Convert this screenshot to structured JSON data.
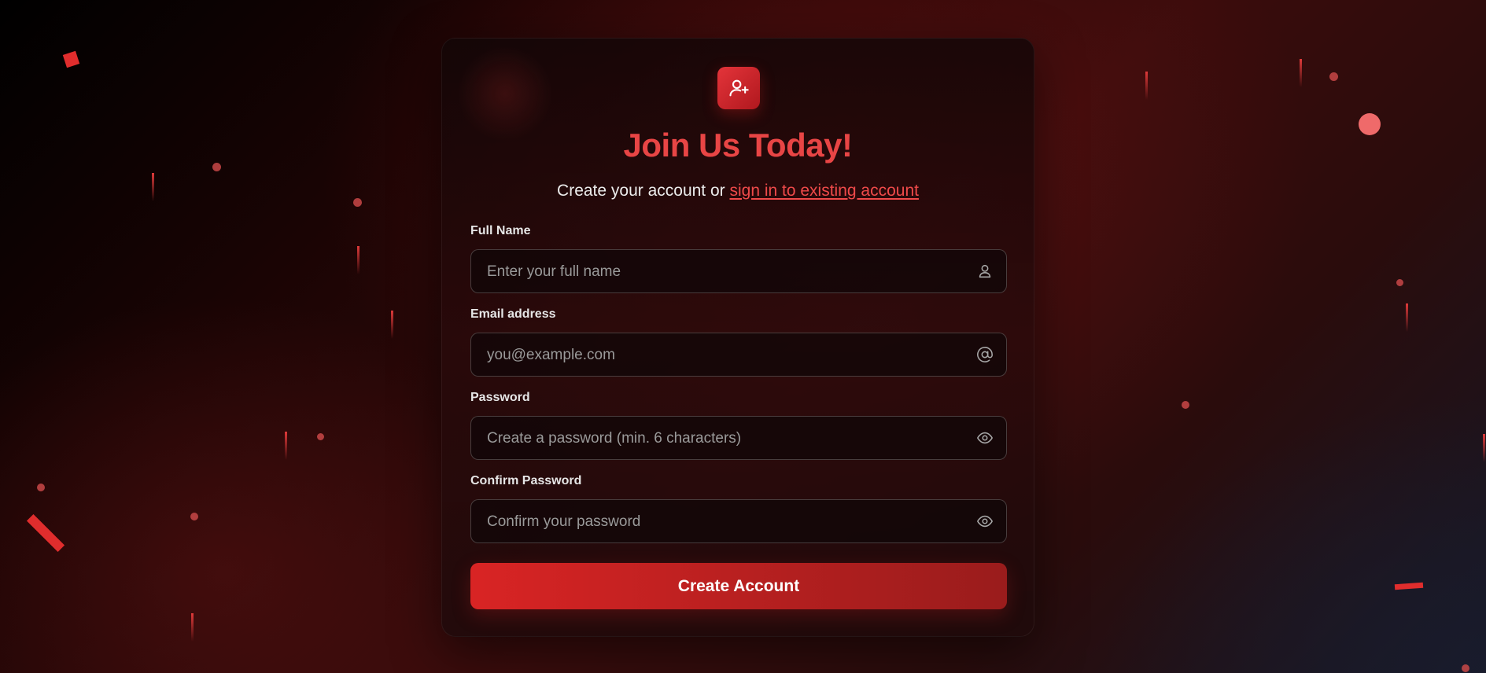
{
  "signup": {
    "title": "Join Us Today!",
    "subtitle_prefix": "Create your account or ",
    "signin_link": "sign in to existing account",
    "fields": {
      "full_name": {
        "label": "Full Name",
        "placeholder": "Enter your full name",
        "value": "",
        "icon": "user-icon"
      },
      "email": {
        "label": "Email address",
        "placeholder": "you@example.com",
        "value": "",
        "icon": "at-sign-icon"
      },
      "password": {
        "label": "Password",
        "placeholder": "Create a password (min. 6 characters)",
        "value": "",
        "icon": "eye-icon"
      },
      "confirm_password": {
        "label": "Confirm Password",
        "placeholder": "Confirm your password",
        "value": "",
        "icon": "eye-icon"
      }
    },
    "submit_label": "Create Account",
    "logo_icon": "user-plus-icon"
  },
  "theme": {
    "accent": "#e84545",
    "button_start": "#d92424",
    "button_end": "#9a1c1c",
    "background_dark": "#000000",
    "background_red": "#3a0c0c"
  }
}
